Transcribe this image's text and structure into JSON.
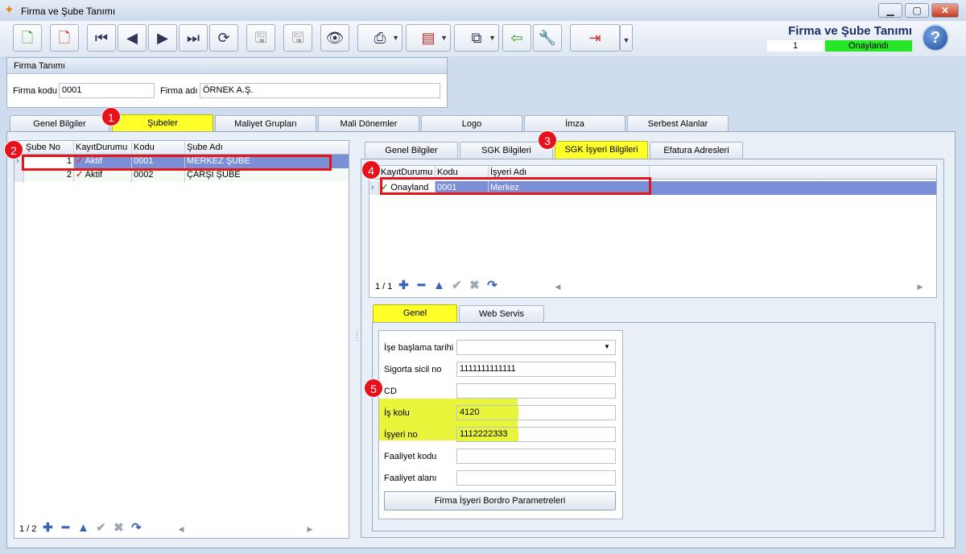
{
  "window": {
    "title": "Firma ve Şube Tanımı"
  },
  "header": {
    "title": "Firma ve Şube Tanımı",
    "record_number": "1",
    "status": "Onaylandı"
  },
  "firma": {
    "group_title": "Firma Tanımı",
    "code_label": "Firma kodu",
    "code_value": "0001",
    "name_label": "Firma adı",
    "name_value": "ÖRNEK A.Ş."
  },
  "main_tabs": [
    "Genel Bilgiler",
    "Şubeler",
    "Maliyet Grupları",
    "Mali Dönemler",
    "Logo",
    "İmza",
    "Serbest Alanlar"
  ],
  "subeler_grid": {
    "columns": [
      "Şube No",
      "KayıtDurumu",
      "Kodu",
      "Şube Adı"
    ],
    "rows": [
      {
        "no": "1",
        "status": "Aktif",
        "code": "0001",
        "name": "MERKEZ ŞUBE"
      },
      {
        "no": "2",
        "status": "Aktif",
        "code": "0002",
        "name": "ÇARŞI ŞUBE"
      }
    ],
    "pager": "1 / 2"
  },
  "sub_tabs": [
    "Genel Bilgiler",
    "SGK Bilgileri",
    "SGK İşyeri Bilgileri",
    "Efatura Adresleri"
  ],
  "sgk_grid": {
    "columns": [
      "KayıtDurumu",
      "Kodu",
      "İşyeri Adı"
    ],
    "rows": [
      {
        "status": "Onayland",
        "code": "0001",
        "name": "Merkez"
      }
    ],
    "pager": "1 / 1"
  },
  "detail_tabs": [
    "Genel",
    "Web Servis"
  ],
  "form": {
    "ise_baslama_label": "İşe başlama tarihi",
    "ise_baslama_value": "",
    "sigorta_sicil_label": "Sigorta sicil no",
    "sigorta_sicil_value": "1111111111111",
    "cd_label": "CD",
    "cd_value": "",
    "is_kolu_label": "İş kolu",
    "is_kolu_value": "4120",
    "isyeri_no_label": "İşyeri no",
    "isyeri_no_value": "1112222333",
    "faaliyet_kodu_label": "Faaliyet kodu",
    "faaliyet_kodu_value": "",
    "faaliyet_alani_label": "Faaliyet alanı",
    "faaliyet_alani_value": "",
    "bordro_button": "Firma İşyeri Bordro Parametreleri"
  },
  "badges": [
    "1",
    "2",
    "3",
    "4",
    "5"
  ],
  "colors": {
    "highlight": "#ffff2a",
    "status_green": "#27e627",
    "selection": "#7b8fd6",
    "annotation_red": "#e2161b"
  }
}
